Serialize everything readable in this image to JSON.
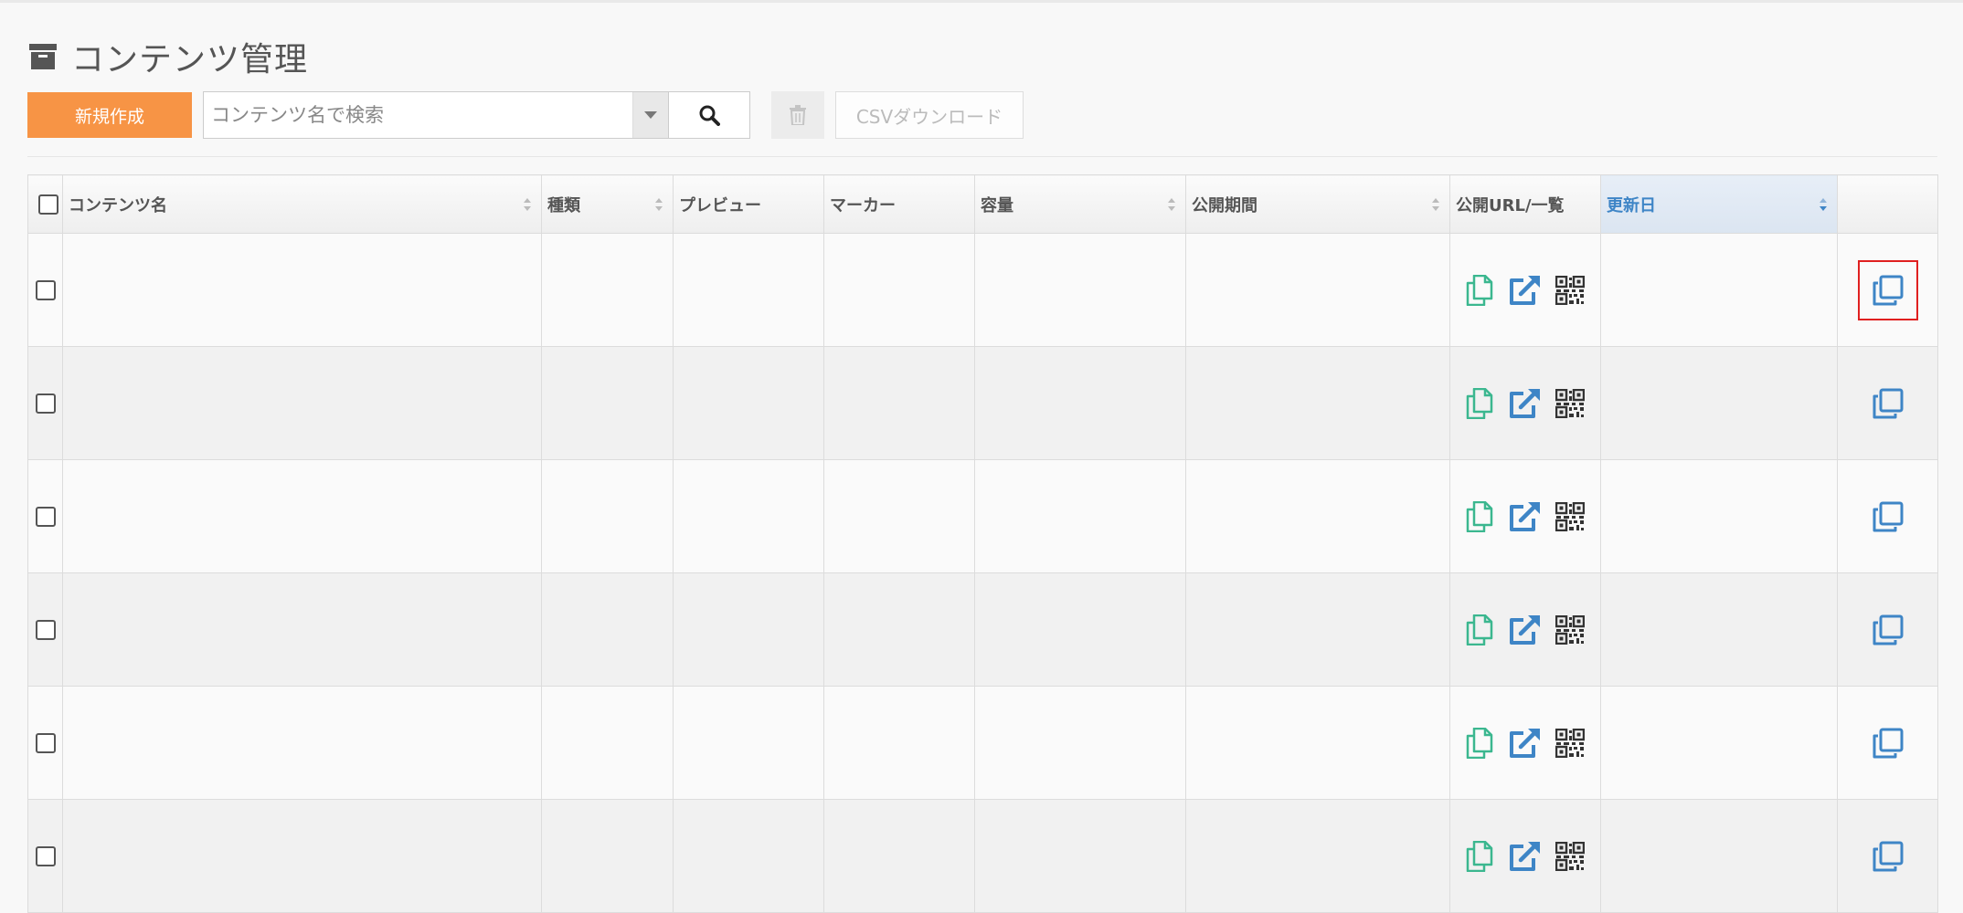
{
  "page": {
    "title": "コンテンツ管理",
    "icon": "archive-icon"
  },
  "toolbar": {
    "new_label": "新規作成",
    "search_placeholder": "コンテンツ名で検索",
    "search_icon": "search-icon",
    "delete_icon": "trash-icon",
    "csv_label": "CSVダウンロード"
  },
  "table": {
    "columns": [
      {
        "key": "name",
        "label": "コンテンツ名",
        "sortable": true
      },
      {
        "key": "type",
        "label": "種類",
        "sortable": true
      },
      {
        "key": "preview",
        "label": "プレビュー",
        "sortable": false
      },
      {
        "key": "marker",
        "label": "マーカー",
        "sortable": false
      },
      {
        "key": "size",
        "label": "容量",
        "sortable": true
      },
      {
        "key": "period",
        "label": "公開期間",
        "sortable": true
      },
      {
        "key": "url",
        "label": "公開URL/一覧",
        "sortable": false
      },
      {
        "key": "updated",
        "label": "更新日",
        "sortable": true,
        "sorted": "desc"
      }
    ],
    "rows": [
      {
        "duplicate_highlighted": true
      },
      {
        "duplicate_highlighted": false
      },
      {
        "duplicate_highlighted": false
      },
      {
        "duplicate_highlighted": false
      },
      {
        "duplicate_highlighted": false
      },
      {
        "duplicate_highlighted": false
      }
    ],
    "row_icons": [
      "copy-url-icon",
      "external-link-icon",
      "qr-code-icon",
      "duplicate-icon"
    ]
  },
  "colors": {
    "accent_orange": "#f79445",
    "link_blue": "#3e85c6",
    "copy_green": "#3bb78f",
    "highlight_red": "#e02020"
  }
}
